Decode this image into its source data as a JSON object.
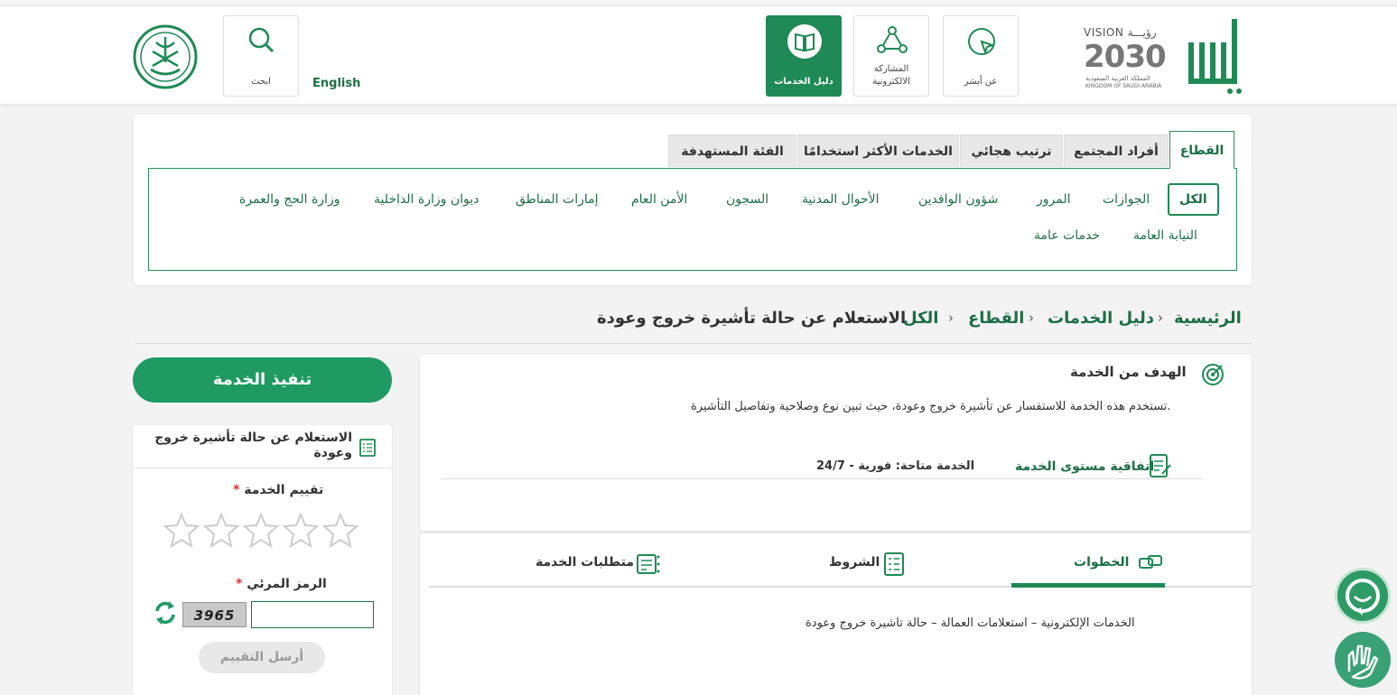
{
  "header": {
    "nav": [
      {
        "label": "عن أبشر",
        "icon": "cursor-click-icon"
      },
      {
        "label": "المشاركة\nالالكترونية",
        "icon": "share-network-icon"
      },
      {
        "label": "دليل الخدمات",
        "icon": "book-icon"
      }
    ],
    "lang": "English",
    "search_label": "ابحث",
    "vision": {
      "top": "VISION رؤيـــة",
      "num": "2030",
      "sub_ar": "المملكة العربية السعودية",
      "sub_en": "KINGDOM OF SAUDI ARABIA"
    }
  },
  "filter": {
    "tabs": [
      "القطاع",
      "أفراد المجتمع",
      "ترتيب هجائي",
      "الخدمات الأكثر استخدامًا",
      "الفئة المستهدفة"
    ],
    "row1": [
      "الكل",
      "الجوازات",
      "المرور",
      "شؤون الوافدين",
      "الأحوال المدنية",
      "السجون",
      "الأمن العام",
      "إمارات المناطق",
      "ديوان وزارة الداخلية",
      "وزارة الحج والعمرة"
    ],
    "row2": [
      "النيابة العامة",
      "خدمات عامة"
    ]
  },
  "breadcrumb": [
    "الرئيسية",
    "دليل الخدمات",
    "القطاع",
    "الكل",
    "الاستعلام عن حالة تأشيرة خروج وعودة"
  ],
  "goal": {
    "title": "الهدف من الخدمة",
    "description": "تستخدم هذه الخدمة للاستفسار عن تأشيرة خروج وعودة، حيث تبين نوع وصلاحية وتفاصيل التأشيرة.",
    "sla_label": "اتفاقية مستوى الخدمة",
    "availability": "الخدمة متاحة: فورية - 24/7"
  },
  "details": {
    "tabs": [
      "الخطوات",
      "الشروط",
      "متطلبات الخدمة"
    ],
    "steps": "الخدمات الإلكترونية – استعلامات العمالة – حالة تاشيرة خروج وعودة"
  },
  "sidebar": {
    "exec": "تنفيذ الخدمة",
    "service_title": "الاستعلام عن حالة تأشيرة خروج وعودة",
    "rating_label": "تقييم الخدمة",
    "captcha_label": "الرمز المرئي",
    "captcha_value": "3965",
    "send": "أرسل التقييم",
    "rating": 0
  },
  "colors": {
    "primary": "#1f8a55",
    "accent": "#1d6e45"
  }
}
